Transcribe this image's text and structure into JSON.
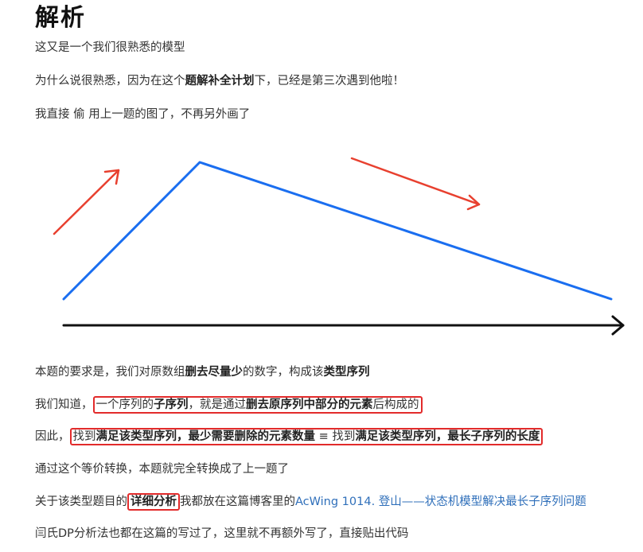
{
  "heading": "解析",
  "p1": "这又是一个我们很熟悉的模型",
  "p2": {
    "a": "为什么说很熟悉，因为在这个",
    "b": "题解补全计划",
    "c": "下，已经是第三次遇到他啦！"
  },
  "p3": "我直接 偷 用上一题的图了，不再另外画了",
  "p4": {
    "a": "本题的要求是，我们对原数组",
    "b": "删去尽量少",
    "c": "的数字，构成该",
    "d": "类型序列"
  },
  "p5": {
    "a": "我们知道，",
    "b": "一个序列的",
    "c": "子序列",
    "d": "，就是通过",
    "e": "删去原序列中部分的元素",
    "f": "后构成的"
  },
  "p6": {
    "a": "因此，",
    "b": "找到",
    "c": "满足该类型序列",
    "d": "，",
    "e": "最少需要删除的元素数量",
    "f": " ≡ 找到",
    "g": "满足该类型序列",
    "h": "，",
    "i": "最长子序列的长度"
  },
  "p7": "通过这个等价转换，本题就完全转换成了上一题了",
  "p8": {
    "a": "关于该类型题目的",
    "b": "详细分析",
    "c": "我都放在这篇博客里的",
    "link": "AcWing 1014. 登山——状态机模型解决最长子序列问题"
  },
  "p9": "闫氏DP分析法也都在这篇的写过了，这里就不再额外写了，直接贴出代码",
  "colors": {
    "rise_line": "#1a6ef0",
    "arrow_red": "#e8402f",
    "axis": "#111111",
    "highlight_box": "#e22b2b",
    "link": "#2f6fba"
  }
}
